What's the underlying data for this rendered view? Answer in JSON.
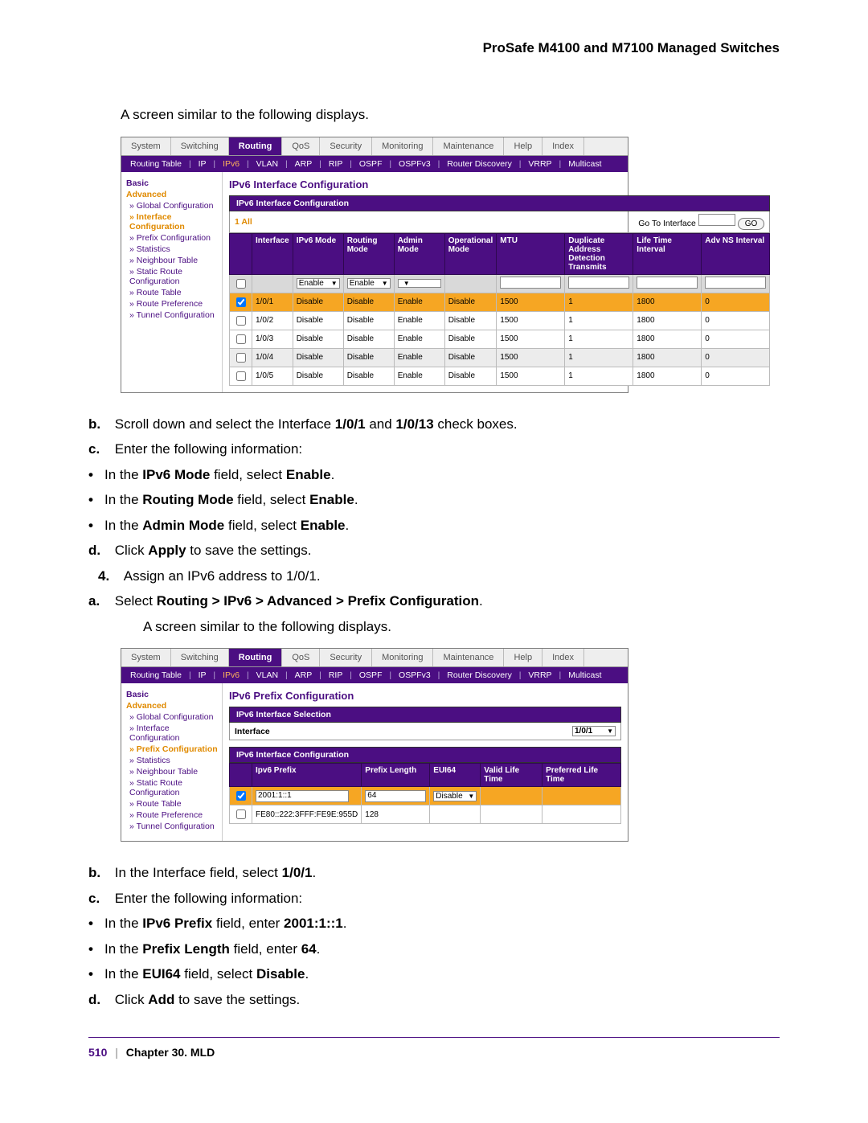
{
  "header": "ProSafe M4100 and M7100 Managed Switches",
  "intro1": "A screen similar to the following displays.",
  "screenshot1": {
    "tabs": [
      "System",
      "Switching",
      "Routing",
      "QoS",
      "Security",
      "Monitoring",
      "Maintenance",
      "Help",
      "Index"
    ],
    "active_tab": "Routing",
    "subnav": [
      "Routing Table",
      "IP",
      "IPv6",
      "VLAN",
      "ARP",
      "RIP",
      "OSPF",
      "OSPFv3",
      "Router Discovery",
      "VRRP",
      "Multicast"
    ],
    "subnav_on": "IPv6",
    "side": {
      "basic": "Basic",
      "advanced": "Advanced",
      "items": [
        "Global Configuration",
        "Interface Configuration",
        "Prefix Configuration",
        "Statistics",
        "Neighbour Table",
        "Static Route Configuration",
        "Route Table",
        "Route Preference",
        "Tunnel Configuration"
      ],
      "highlight_idx": 1
    },
    "section_title": "IPv6 Interface Configuration",
    "subsection": "IPv6 Interface Configuration",
    "toolbar": {
      "filter_label": "1 All",
      "goto_label": "Go To Interface",
      "go": "GO"
    },
    "columns": [
      "",
      "Interface",
      "IPv6 Mode",
      "Routing Mode",
      "Admin Mode",
      "Operational Mode",
      "MTU",
      "Duplicate Address Detection Transmits",
      "Life Time Interval",
      "Adv NS Interval"
    ],
    "edit_row": {
      "ipv6_mode": "Enable",
      "routing_mode": "Enable",
      "admin_mode": ""
    },
    "rows": [
      {
        "sel": true,
        "iface": "1/0/1",
        "ipv6": "Disable",
        "route": "Disable",
        "admin": "Enable",
        "oper": "Disable",
        "mtu": "1500",
        "dad": "1",
        "life": "1800",
        "adv": "0",
        "hl": true
      },
      {
        "sel": false,
        "iface": "1/0/2",
        "ipv6": "Disable",
        "route": "Disable",
        "admin": "Enable",
        "oper": "Disable",
        "mtu": "1500",
        "dad": "1",
        "life": "1800",
        "adv": "0"
      },
      {
        "sel": false,
        "iface": "1/0/3",
        "ipv6": "Disable",
        "route": "Disable",
        "admin": "Enable",
        "oper": "Disable",
        "mtu": "1500",
        "dad": "1",
        "life": "1800",
        "adv": "0"
      },
      {
        "sel": false,
        "iface": "1/0/4",
        "ipv6": "Disable",
        "route": "Disable",
        "admin": "Enable",
        "oper": "Disable",
        "mtu": "1500",
        "dad": "1",
        "life": "1800",
        "adv": "0",
        "alt": true
      },
      {
        "sel": false,
        "iface": "1/0/5",
        "ipv6": "Disable",
        "route": "Disable",
        "admin": "Enable",
        "oper": "Disable",
        "mtu": "1500",
        "dad": "1",
        "life": "1800",
        "adv": "0"
      }
    ]
  },
  "steps_after_shot1": {
    "b": {
      "marker": "b.",
      "pre": "Scroll down and select the Interface ",
      "bold1": "1/0/1",
      "mid": " and ",
      "bold2": "1/0/13",
      "post": " check boxes."
    },
    "c": {
      "marker": "c.",
      "text": "Enter the following information:"
    },
    "c_items": [
      {
        "pre": "In the ",
        "bold": "IPv6 Mode",
        "mid": " field, select ",
        "bold2": "Enable",
        "post": "."
      },
      {
        "pre": "In the ",
        "bold": "Routing Mode",
        "mid": " field, select ",
        "bold2": "Enable",
        "post": "."
      },
      {
        "pre": "In the ",
        "bold": "Admin Mode",
        "mid": " field, select ",
        "bold2": "Enable",
        "post": "."
      }
    ],
    "d": {
      "marker": "d.",
      "pre": "Click ",
      "bold": "Apply",
      "post": " to save the settings."
    }
  },
  "step4": {
    "marker": "4.",
    "text": "Assign an IPv6 address to 1/0/1."
  },
  "step4a": {
    "marker": "a.",
    "pre": "Select ",
    "bold": "Routing > IPv6 > Advanced > Prefix Configuration",
    "post": "."
  },
  "intro2": "A screen similar to the following displays.",
  "screenshot2": {
    "tabs": [
      "System",
      "Switching",
      "Routing",
      "QoS",
      "Security",
      "Monitoring",
      "Maintenance",
      "Help",
      "Index"
    ],
    "active_tab": "Routing",
    "subnav": [
      "Routing Table",
      "IP",
      "IPv6",
      "VLAN",
      "ARP",
      "RIP",
      "OSPF",
      "OSPFv3",
      "Router Discovery",
      "VRRP",
      "Multicast"
    ],
    "subnav_on": "IPv6",
    "side": {
      "basic": "Basic",
      "advanced": "Advanced",
      "items": [
        "Global Configuration",
        "Interface Configuration",
        "Prefix Configuration",
        "Statistics",
        "Neighbour Table",
        "Static Route Configuration",
        "Route Table",
        "Route Preference",
        "Tunnel Configuration"
      ],
      "highlight_idx": 2
    },
    "section_title": "IPv6 Prefix Configuration",
    "sub1": "IPv6 Interface Selection",
    "iface_row": {
      "label": "Interface",
      "value": "1/0/1"
    },
    "sub2": "IPv6 Interface Configuration",
    "columns": [
      "",
      "Ipv6 Prefix",
      "Prefix Length",
      "EUI64",
      "Valid Life Time",
      "Preferred Life Time"
    ],
    "rows": [
      {
        "sel": true,
        "prefix": "2001:1::1",
        "len": "64",
        "eui": "Disable",
        "hl": true
      },
      {
        "sel": false,
        "prefix": "FE80::222:3FFF:FE9E:955D",
        "len": "128",
        "eui": ""
      }
    ]
  },
  "steps_after_shot2": {
    "b": {
      "marker": "b.",
      "pre": "In the Interface field, select ",
      "bold": "1/0/1",
      "post": "."
    },
    "c": {
      "marker": "c.",
      "text": "Enter the following information:"
    },
    "c_items": [
      {
        "pre": "In the ",
        "bold": "IPv6 Prefix",
        "mid": " field, enter ",
        "bold2": "2001:1::1",
        "post": "."
      },
      {
        "pre": "In the ",
        "bold": "Prefix Length",
        "mid": " field, enter ",
        "bold2": "64",
        "post": "."
      },
      {
        "pre": "In the ",
        "bold": "EUI64",
        "mid": " field, select ",
        "bold2": "Disable",
        "post": "."
      }
    ],
    "d": {
      "marker": "d.",
      "pre": "Click ",
      "bold": "Add",
      "post": " to save the settings."
    }
  },
  "footer": {
    "page": "510",
    "chapter": "Chapter 30.  MLD"
  }
}
